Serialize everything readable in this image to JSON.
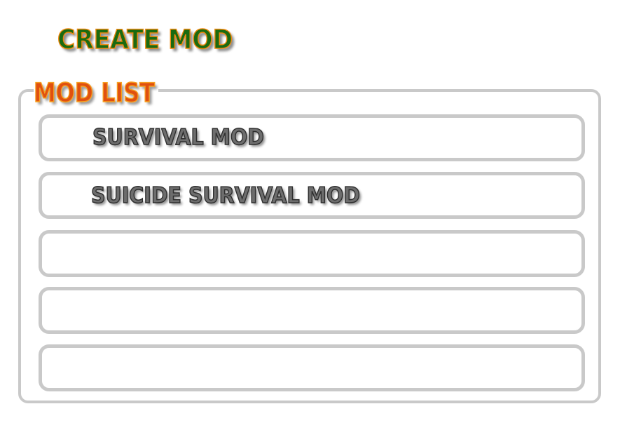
{
  "header": {
    "create_mod_label": "CREATE MOD"
  },
  "mod_list": {
    "title": "MOD LIST",
    "slots": [
      {
        "label": "SURVIVAL MOD"
      },
      {
        "label": "SUICIDE SURVIVAL MOD"
      },
      {
        "label": ""
      },
      {
        "label": ""
      },
      {
        "label": ""
      }
    ]
  },
  "colors": {
    "create_mod_fill": "#1a6a10",
    "create_mod_outline": "#f08a10",
    "mod_list_fill": "#e05010",
    "panel_border": "#c9c9c9",
    "slot_text": "#6d6d6d"
  }
}
